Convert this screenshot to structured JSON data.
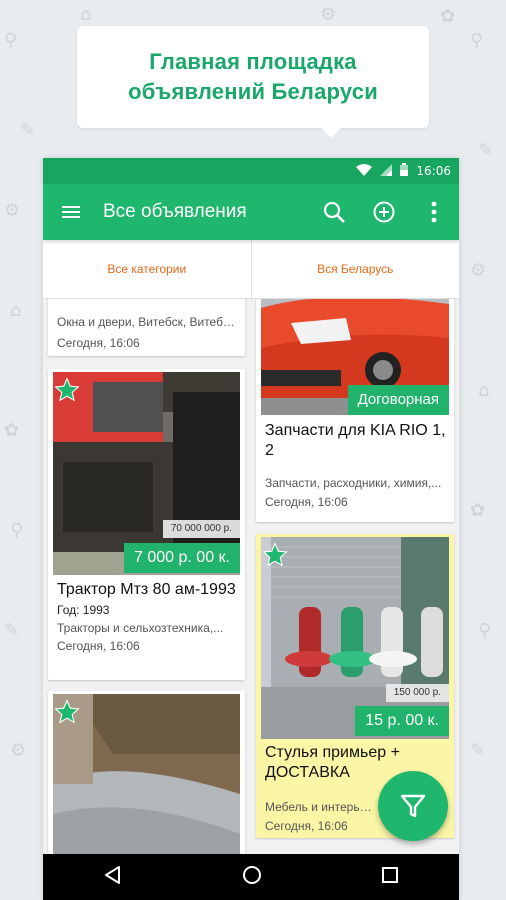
{
  "promo": {
    "line1": "Главная площадка",
    "line2": "объявлений Беларуси"
  },
  "status_bar": {
    "time": "16:06"
  },
  "app_bar": {
    "title": "Все объявления",
    "icons": [
      "menu-icon",
      "search-icon",
      "add-circle-icon",
      "more-vert-icon"
    ]
  },
  "filters": {
    "category": "Все категории",
    "region": "Вся Беларусь"
  },
  "listings": [
    {
      "meta": "Окна и двери, Витебск, Витебск...",
      "date": "Сегодня, 16:06"
    },
    {
      "price": "Договорная",
      "title": "Запчасти для KIA RIO 1, 2",
      "meta": "Запчасти, расходники, химия,...",
      "date": "Сегодня, 16:06"
    },
    {
      "old_price": "70 000 000 р.",
      "price": "7 000 р. 00 к.",
      "title": "Трактор Мтз 80 ам-1993",
      "year": "Год: 1993",
      "meta": "Тракторы и сельхозтехника,...",
      "date": "Сегодня, 16:06",
      "featured": true
    },
    {
      "old_price": "150 000 р.",
      "price": "15 р. 00 к.",
      "title": "Стулья примьер + ДОСТАВКА",
      "meta": "Мебель и интерьер, Гомел...",
      "date": "Сегодня, 16:06",
      "featured": true
    },
    {
      "featured": true
    }
  ],
  "colors": {
    "brand_green": "#1fb76d",
    "status_green": "#17a55f",
    "filter_orange": "#e66a1a",
    "highlight_yellow": "#fbf6a6"
  }
}
